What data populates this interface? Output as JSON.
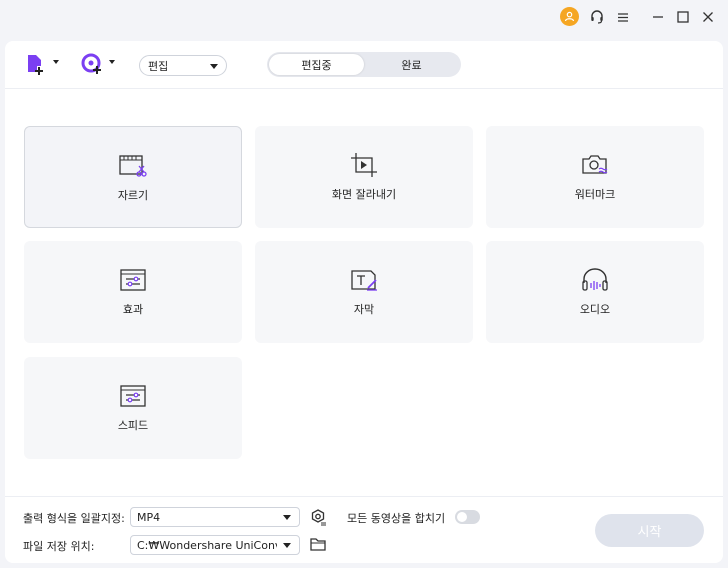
{
  "titlebar": {
    "icons": [
      "user-icon",
      "support-icon",
      "menu-icon",
      "minimize-icon",
      "maximize-icon",
      "close-icon"
    ],
    "accent": "#f5a623"
  },
  "toolbar": {
    "add_file_icon": "add-file-icon",
    "add_media_icon": "add-media-icon",
    "mode_select": "편집",
    "tabs": [
      "편집중",
      "완료"
    ]
  },
  "tiles": [
    {
      "label": "자르기",
      "icon": "trim-icon"
    },
    {
      "label": "화면 잘라내기",
      "icon": "crop-icon"
    },
    {
      "label": "워터마크",
      "icon": "watermark-icon"
    },
    {
      "label": "효과",
      "icon": "effect-icon"
    },
    {
      "label": "자막",
      "icon": "subtitle-icon"
    },
    {
      "label": "오디오",
      "icon": "audio-icon"
    },
    {
      "label": "스피드",
      "icon": "speed-icon"
    }
  ],
  "footer": {
    "format_label": "출력 형식을 일괄지정:",
    "format_value": "MP4",
    "merge_label": "모든 동영상을 합치기",
    "location_label": "파일 저장 위치:",
    "location_value": "C:₩Wondershare UniConverte",
    "start_label": "시작"
  },
  "colors": {
    "icon_accent": "#7b3ff2",
    "start_bg": "#dfe3ec"
  }
}
